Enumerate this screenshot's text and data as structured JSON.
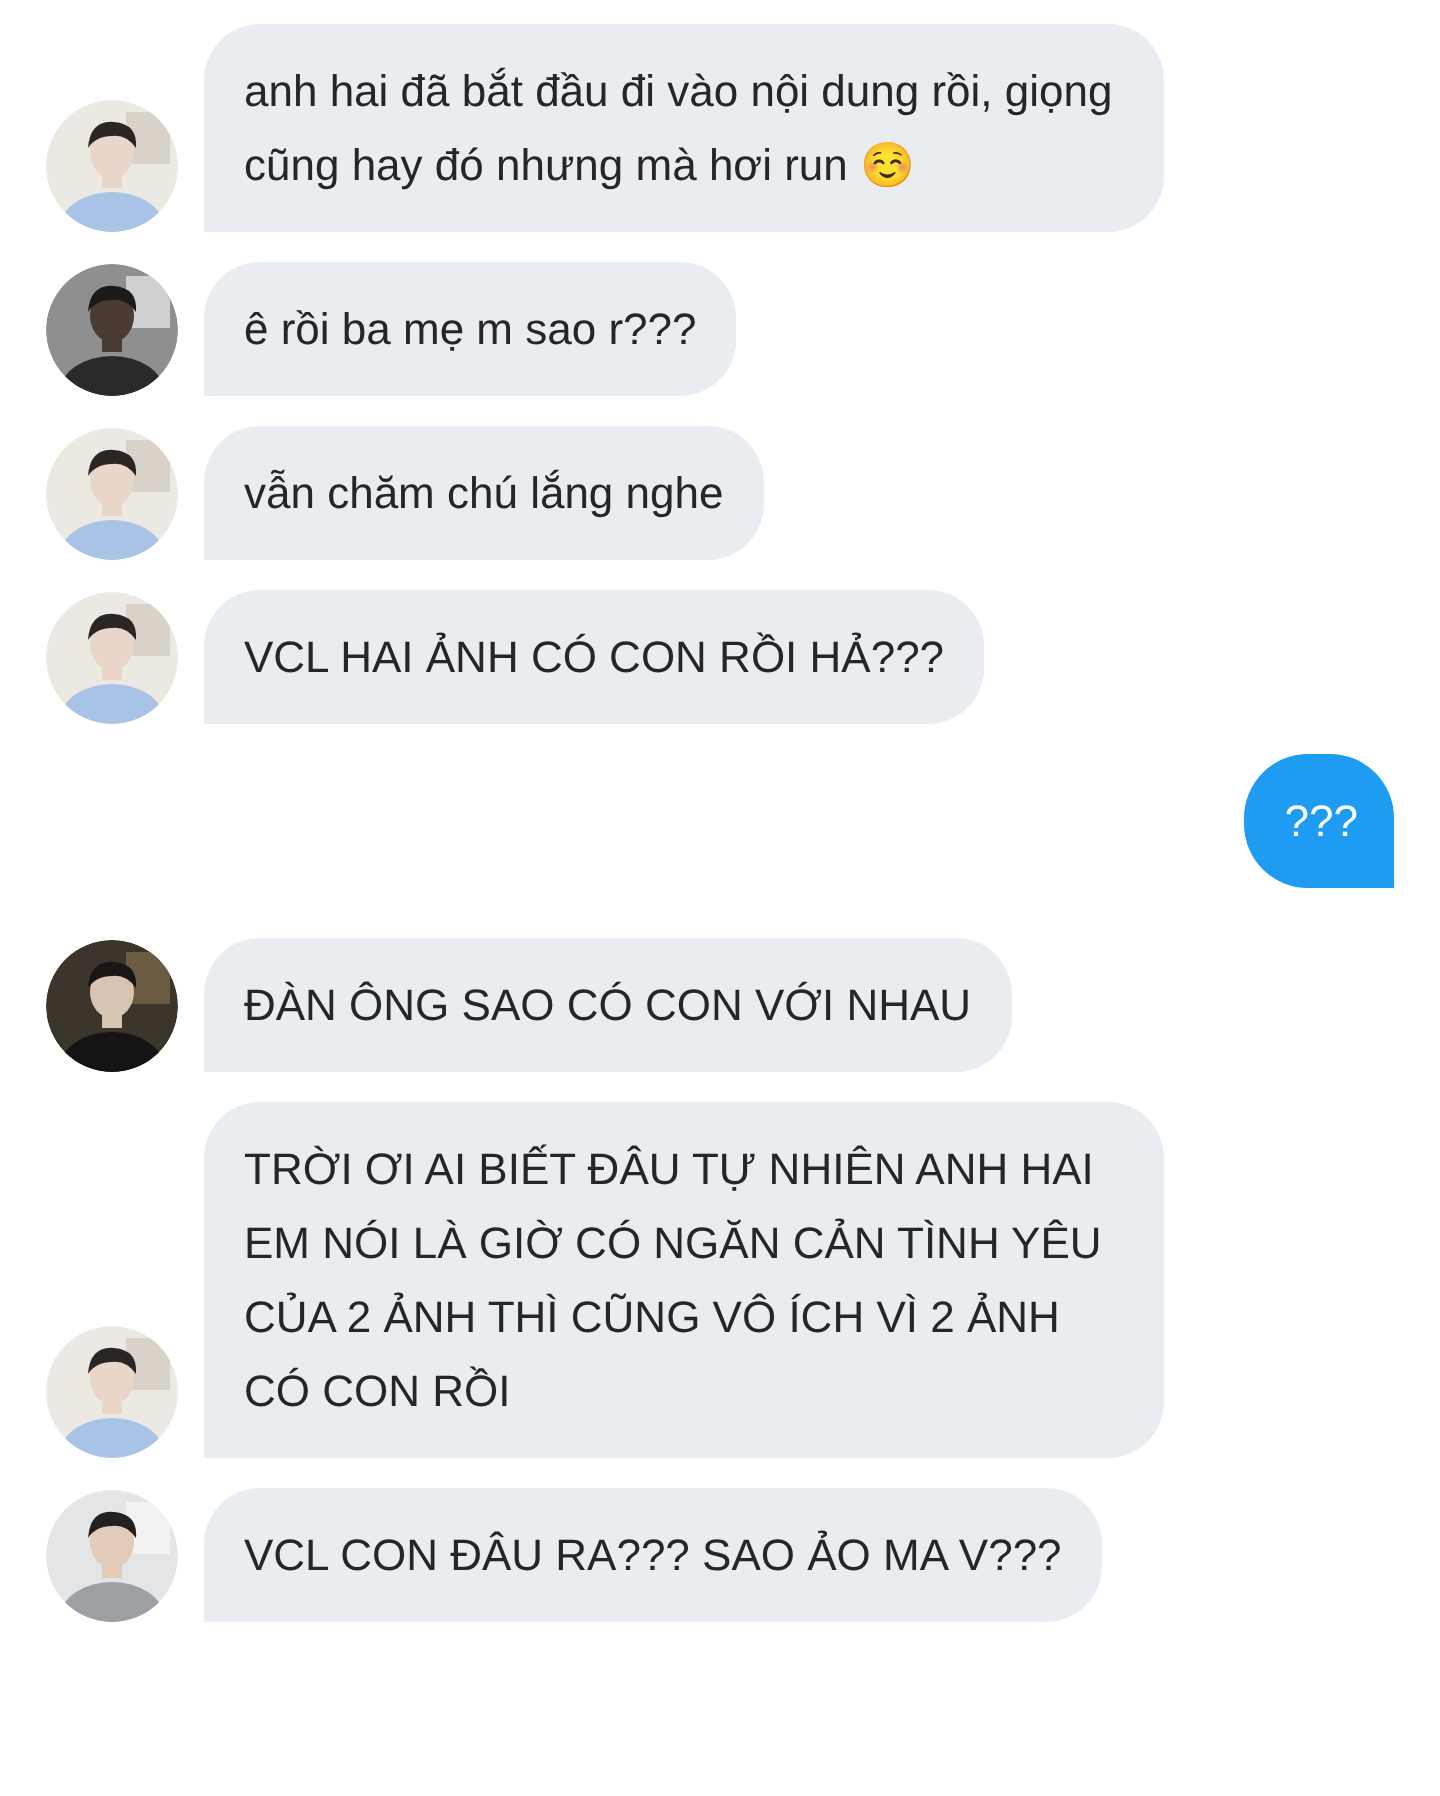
{
  "messages": [
    {
      "kind": "incoming",
      "text": "anh hai đã bắt đầu đi vào nội dung rồi, giọng cũng hay đó nhưng mà hơi run ☺️"
    },
    {
      "kind": "incoming",
      "text": "ê rồi ba mẹ m sao r???"
    },
    {
      "kind": "incoming",
      "text": "vẫn chăm chú lắng nghe"
    },
    {
      "kind": "incoming",
      "text": "VCL HAI ẢNH CÓ CON RỒI HẢ???"
    },
    {
      "kind": "outgoing",
      "text": "???"
    },
    {
      "kind": "incoming",
      "text": "ĐÀN ÔNG SAO CÓ CON VỚI NHAU"
    },
    {
      "kind": "incoming",
      "text": "TRỜI ƠI AI BIẾT ĐÂU TỰ NHIÊN ANH HAI EM NÓI LÀ GIỜ CÓ NGĂN CẢN TÌNH YÊU CỦA 2 ẢNH THÌ CŨNG VÔ ÍCH VÌ 2 ẢNH CÓ CON RỒI"
    },
    {
      "kind": "incoming",
      "text": "VCL CON ĐÂU RA??? SAO ẢO MA V???"
    }
  ]
}
